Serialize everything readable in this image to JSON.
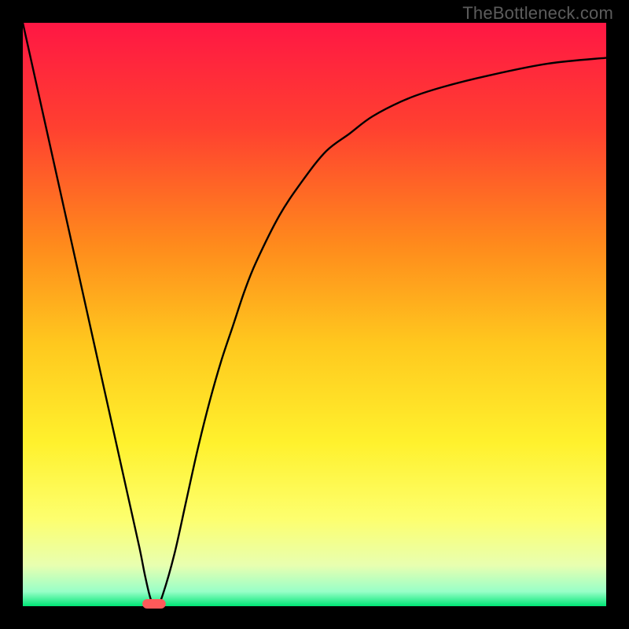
{
  "watermark": "TheBottleneck.com",
  "chart_data": {
    "type": "line",
    "title": "",
    "xlabel": "",
    "ylabel": "",
    "xlim": [
      0,
      100
    ],
    "ylim": [
      0,
      100
    ],
    "grid": false,
    "legend": false,
    "background_gradient": {
      "stops": [
        {
          "pos": 0.0,
          "color": "#ff1744"
        },
        {
          "pos": 0.18,
          "color": "#ff4030"
        },
        {
          "pos": 0.38,
          "color": "#ff8a1c"
        },
        {
          "pos": 0.55,
          "color": "#ffc81e"
        },
        {
          "pos": 0.72,
          "color": "#fff12d"
        },
        {
          "pos": 0.85,
          "color": "#fdff6e"
        },
        {
          "pos": 0.93,
          "color": "#e8ffb0"
        },
        {
          "pos": 0.975,
          "color": "#98ffc8"
        },
        {
          "pos": 1.0,
          "color": "#00e676"
        }
      ]
    },
    "series": [
      {
        "name": "bottleneck-curve",
        "color": "#000000",
        "x": [
          0,
          2,
          4,
          6,
          8,
          10,
          12,
          14,
          16,
          18,
          20,
          21,
          22,
          23,
          24,
          26,
          28,
          30,
          32,
          34,
          36,
          38,
          40,
          44,
          48,
          52,
          56,
          60,
          66,
          72,
          80,
          90,
          100
        ],
        "y": [
          100,
          91,
          82,
          73,
          64,
          55,
          46,
          37,
          28,
          19,
          10,
          5,
          1,
          0,
          2,
          9,
          18,
          27,
          35,
          42,
          48,
          54,
          59,
          67,
          73,
          78,
          81,
          84,
          87,
          89,
          91,
          93,
          94
        ]
      }
    ],
    "marker": {
      "name": "optimum-marker",
      "color": "#ff5a5a",
      "x": 22.5,
      "width": 4,
      "y": 0
    }
  },
  "plot": {
    "outer_size": 800,
    "inner_left": 29,
    "inner_top": 29,
    "inner_width": 742,
    "inner_height": 742
  }
}
